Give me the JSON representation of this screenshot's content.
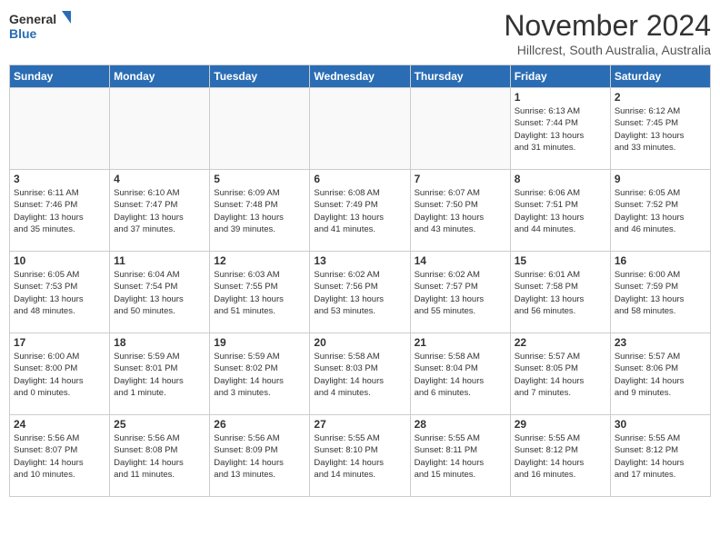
{
  "header": {
    "logo_general": "General",
    "logo_blue": "Blue",
    "month_title": "November 2024",
    "subtitle": "Hillcrest, South Australia, Australia"
  },
  "days_of_week": [
    "Sunday",
    "Monday",
    "Tuesday",
    "Wednesday",
    "Thursday",
    "Friday",
    "Saturday"
  ],
  "weeks": [
    [
      {
        "day": "",
        "info": ""
      },
      {
        "day": "",
        "info": ""
      },
      {
        "day": "",
        "info": ""
      },
      {
        "day": "",
        "info": ""
      },
      {
        "day": "",
        "info": ""
      },
      {
        "day": "1",
        "info": "Sunrise: 6:13 AM\nSunset: 7:44 PM\nDaylight: 13 hours\nand 31 minutes."
      },
      {
        "day": "2",
        "info": "Sunrise: 6:12 AM\nSunset: 7:45 PM\nDaylight: 13 hours\nand 33 minutes."
      }
    ],
    [
      {
        "day": "3",
        "info": "Sunrise: 6:11 AM\nSunset: 7:46 PM\nDaylight: 13 hours\nand 35 minutes."
      },
      {
        "day": "4",
        "info": "Sunrise: 6:10 AM\nSunset: 7:47 PM\nDaylight: 13 hours\nand 37 minutes."
      },
      {
        "day": "5",
        "info": "Sunrise: 6:09 AM\nSunset: 7:48 PM\nDaylight: 13 hours\nand 39 minutes."
      },
      {
        "day": "6",
        "info": "Sunrise: 6:08 AM\nSunset: 7:49 PM\nDaylight: 13 hours\nand 41 minutes."
      },
      {
        "day": "7",
        "info": "Sunrise: 6:07 AM\nSunset: 7:50 PM\nDaylight: 13 hours\nand 43 minutes."
      },
      {
        "day": "8",
        "info": "Sunrise: 6:06 AM\nSunset: 7:51 PM\nDaylight: 13 hours\nand 44 minutes."
      },
      {
        "day": "9",
        "info": "Sunrise: 6:05 AM\nSunset: 7:52 PM\nDaylight: 13 hours\nand 46 minutes."
      }
    ],
    [
      {
        "day": "10",
        "info": "Sunrise: 6:05 AM\nSunset: 7:53 PM\nDaylight: 13 hours\nand 48 minutes."
      },
      {
        "day": "11",
        "info": "Sunrise: 6:04 AM\nSunset: 7:54 PM\nDaylight: 13 hours\nand 50 minutes."
      },
      {
        "day": "12",
        "info": "Sunrise: 6:03 AM\nSunset: 7:55 PM\nDaylight: 13 hours\nand 51 minutes."
      },
      {
        "day": "13",
        "info": "Sunrise: 6:02 AM\nSunset: 7:56 PM\nDaylight: 13 hours\nand 53 minutes."
      },
      {
        "day": "14",
        "info": "Sunrise: 6:02 AM\nSunset: 7:57 PM\nDaylight: 13 hours\nand 55 minutes."
      },
      {
        "day": "15",
        "info": "Sunrise: 6:01 AM\nSunset: 7:58 PM\nDaylight: 13 hours\nand 56 minutes."
      },
      {
        "day": "16",
        "info": "Sunrise: 6:00 AM\nSunset: 7:59 PM\nDaylight: 13 hours\nand 58 minutes."
      }
    ],
    [
      {
        "day": "17",
        "info": "Sunrise: 6:00 AM\nSunset: 8:00 PM\nDaylight: 14 hours\nand 0 minutes."
      },
      {
        "day": "18",
        "info": "Sunrise: 5:59 AM\nSunset: 8:01 PM\nDaylight: 14 hours\nand 1 minute."
      },
      {
        "day": "19",
        "info": "Sunrise: 5:59 AM\nSunset: 8:02 PM\nDaylight: 14 hours\nand 3 minutes."
      },
      {
        "day": "20",
        "info": "Sunrise: 5:58 AM\nSunset: 8:03 PM\nDaylight: 14 hours\nand 4 minutes."
      },
      {
        "day": "21",
        "info": "Sunrise: 5:58 AM\nSunset: 8:04 PM\nDaylight: 14 hours\nand 6 minutes."
      },
      {
        "day": "22",
        "info": "Sunrise: 5:57 AM\nSunset: 8:05 PM\nDaylight: 14 hours\nand 7 minutes."
      },
      {
        "day": "23",
        "info": "Sunrise: 5:57 AM\nSunset: 8:06 PM\nDaylight: 14 hours\nand 9 minutes."
      }
    ],
    [
      {
        "day": "24",
        "info": "Sunrise: 5:56 AM\nSunset: 8:07 PM\nDaylight: 14 hours\nand 10 minutes."
      },
      {
        "day": "25",
        "info": "Sunrise: 5:56 AM\nSunset: 8:08 PM\nDaylight: 14 hours\nand 11 minutes."
      },
      {
        "day": "26",
        "info": "Sunrise: 5:56 AM\nSunset: 8:09 PM\nDaylight: 14 hours\nand 13 minutes."
      },
      {
        "day": "27",
        "info": "Sunrise: 5:55 AM\nSunset: 8:10 PM\nDaylight: 14 hours\nand 14 minutes."
      },
      {
        "day": "28",
        "info": "Sunrise: 5:55 AM\nSunset: 8:11 PM\nDaylight: 14 hours\nand 15 minutes."
      },
      {
        "day": "29",
        "info": "Sunrise: 5:55 AM\nSunset: 8:12 PM\nDaylight: 14 hours\nand 16 minutes."
      },
      {
        "day": "30",
        "info": "Sunrise: 5:55 AM\nSunset: 8:12 PM\nDaylight: 14 hours\nand 17 minutes."
      }
    ]
  ]
}
